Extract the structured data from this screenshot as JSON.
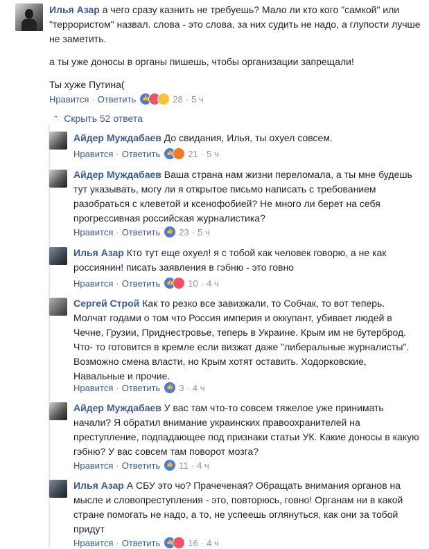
{
  "top_comment": {
    "author": "Илья Азар",
    "text1": "а чего сразу казнить не требуешь? Мало ли кто кого \"самкой\" или \"террористом\" назвал. слова - это слова, за них судить не надо, а глупости лучше не заметить.",
    "text2": "а ты уже доносы в органы пишешь, чтобы организации запрещали!",
    "text3": "Ты хуже Путина(",
    "like": "Нравится",
    "reply": "Ответить",
    "count": "28",
    "time": "5 ч"
  },
  "hide_replies": "Скрыть 52 ответа",
  "replies": [
    {
      "author": "Айдер Муждабаев",
      "text": "До свидания, Илья, ты охуел совсем.",
      "like": "Нравится",
      "reply": "Ответить",
      "count": "21",
      "time": "5 ч"
    },
    {
      "author": "Айдер Муждабаев",
      "text": "Ваша страна нам жизни переломала, а ты мне будешь тут указывать, могу ли я открытое письмо написать с требованием разобраться с клеветой и ксенофобией? Не много ли берет на себя прогрессивная российская журналистика?",
      "like": "Нравится",
      "reply": "Ответить",
      "count": "23",
      "time": "5 ч"
    },
    {
      "author": "Илья Азар",
      "text": "Кто тут еще охуел! я с тобой как человек говорю, а не как россиянин! писать заявления в гэбню - это говно",
      "like": "Нравится",
      "reply": "Ответить",
      "count": "10",
      "time": "4 ч"
    },
    {
      "author": "Сергей Строй",
      "text": "Как то резко все завизжали, то Собчак, то вот теперь. Молчат годами о том что Россия империя и оккупант, убивает людей в Чечне, Грузии, Приднестровье, теперь в Украине. Крым им не бутерброд. Что- то готовится в кремле если визжат даже \"либеральные журналисты\". Возможно смена власти, но Крым хотят оставить. Ходорковские, Навальные и прочие.",
      "like": "Нравится",
      "reply": "Ответить",
      "count": "3",
      "time": "4 ч"
    },
    {
      "author": "Айдер Муждабаев",
      "text": "У вас там что-то совсем тяжелое уже принимать начали? Я обратил внимание украинских правоохранителей на преступление, подпадающее под признаки статьи УК. Какие доносы в какую гэбню? У вас совсем там поворот мозга?",
      "like": "Нравится",
      "reply": "Ответить",
      "count": "11",
      "time": "4 ч"
    },
    {
      "author": "Илья Азар",
      "text": "А СБУ это чо? Прачеченая? Обращать внимания органов на мысле и словопреступления - это, повторюсь, говно! Органам ни в какой стране помогать не надо, а то, не успеешь оглянуться, как они за тобой придут",
      "like": "Нравится",
      "reply": "Ответить",
      "count": "16",
      "time": "4 ч"
    }
  ]
}
